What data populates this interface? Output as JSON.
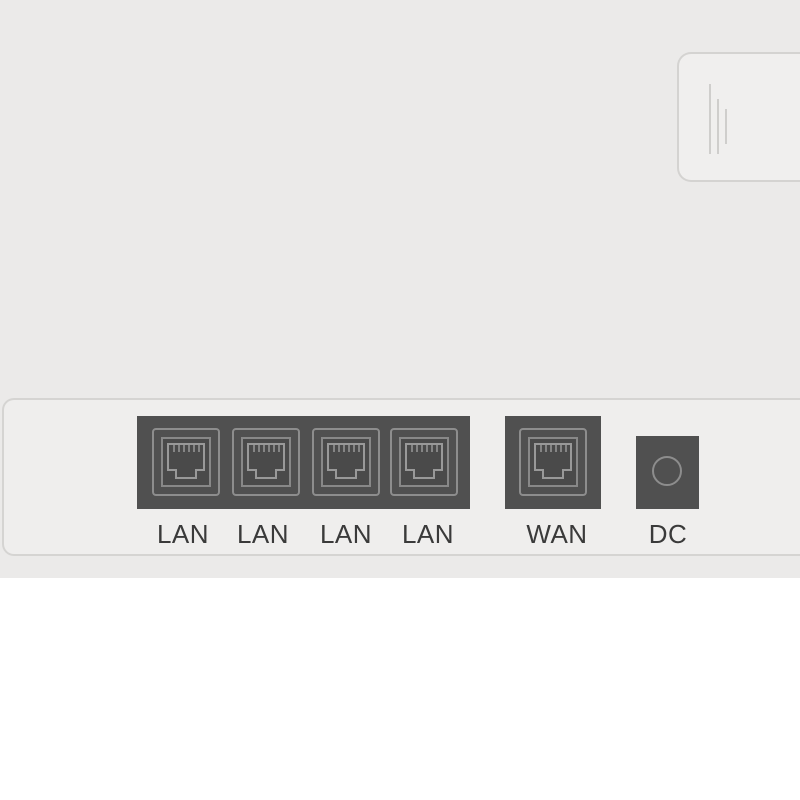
{
  "ports": {
    "lan_1_label": "LAN",
    "lan_2_label": "LAN",
    "lan_3_label": "LAN",
    "lan_4_label": "LAN",
    "wan_label": "WAN",
    "dc_label": "DC"
  },
  "icons": [
    "rj45-port-icon",
    "dc-power-jack-icon",
    "vent-slot-icon"
  ],
  "colors": {
    "device_body": "#ebeae9",
    "port_block": "#505050",
    "port_outline": "#8d8d8d",
    "label_text": "#3a3a3a"
  }
}
